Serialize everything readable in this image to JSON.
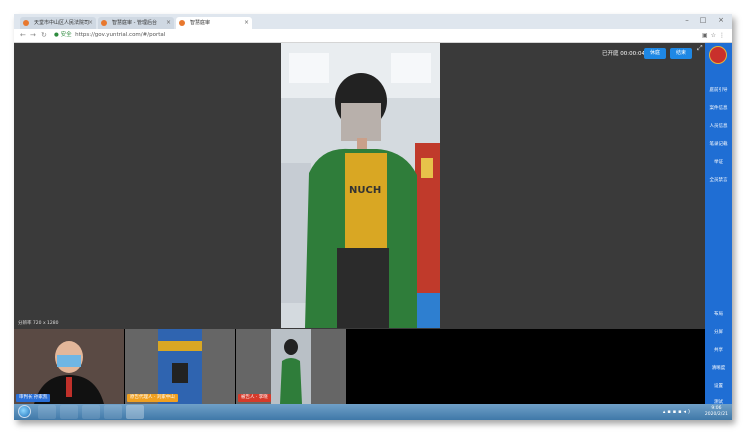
{
  "browser": {
    "tabs": [
      {
        "title": "天堂市中山区人民法院司",
        "fav_color": "#e8782e",
        "active": false
      },
      {
        "title": "智慧庭审 - 管理后台",
        "fav_color": "#e8782e",
        "active": false
      },
      {
        "title": "智慧庭审",
        "fav_color": "#e8782e",
        "active": true
      }
    ],
    "security_label": "安全",
    "url": "https://gov.yuntrial.com/#/portal"
  },
  "session": {
    "elapsed_label": "已开庭 00:00:04",
    "rest_button": "休庭",
    "end_button": "结束"
  },
  "sidebar_top": [
    "庭前引导",
    "案件信息",
    "人员信息",
    "笔录记载",
    "举证",
    "全员禁言"
  ],
  "sidebar_bottom": [
    "布局",
    "分屏",
    "共享",
    "清晰度",
    "设置",
    "测试"
  ],
  "resolution_label": "分辨率 720 x 1280",
  "thumbnails": [
    {
      "label": "审判长 孙家凯",
      "label_color": "#2a6fd6"
    },
    {
      "label": "原告代理人 · 刘家中山",
      "label_color": "#f0a020"
    },
    {
      "label": "被告人 · 李晓",
      "label_color": "#d63a2a"
    }
  ],
  "taskbar": {
    "time": "9:06",
    "date": "2020/2/21"
  },
  "colors": {
    "accent_blue": "#1f6ed4",
    "button_blue": "#1e88e5"
  }
}
